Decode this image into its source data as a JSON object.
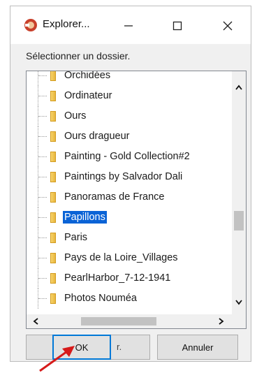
{
  "window": {
    "title": "Explorer...",
    "prompt": "Sélectionner un dossier."
  },
  "tree": {
    "items": [
      {
        "label": "Orchidées",
        "selected": false
      },
      {
        "label": "Ordinateur",
        "selected": false
      },
      {
        "label": "Ours",
        "selected": false
      },
      {
        "label": "Ours dragueur",
        "selected": false
      },
      {
        "label": "Painting - Gold Collection#2",
        "selected": false
      },
      {
        "label": "Paintings by Salvador Dali",
        "selected": false
      },
      {
        "label": "Panoramas de France",
        "selected": false
      },
      {
        "label": "Papillons",
        "selected": true
      },
      {
        "label": "Paris",
        "selected": false
      },
      {
        "label": "Pays de la Loire_Villages",
        "selected": false
      },
      {
        "label": "PearlHarbor_7-12-1941",
        "selected": false
      },
      {
        "label": "Photos Nouméa",
        "selected": false
      }
    ]
  },
  "buttons": {
    "ok": "OK",
    "middle_partial": "r.",
    "cancel": "Annuler"
  },
  "colors": {
    "selection": "#0a63d6",
    "annotation_arrow": "#d61a1a"
  }
}
